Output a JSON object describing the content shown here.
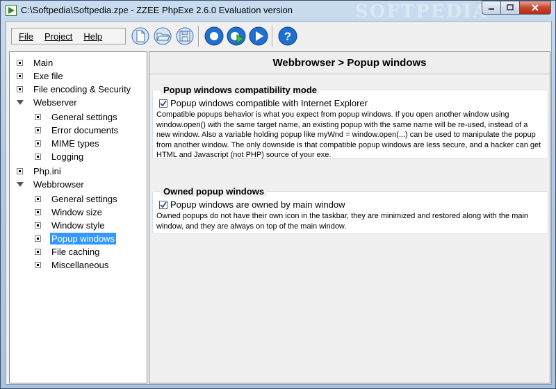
{
  "window": {
    "title": "C:\\Softpedia\\Softpedia.zpe - ZZEE PhpExe 2.6.0 Evaluation version",
    "watermark": "SOFTPEDIA"
  },
  "menu": {
    "file": "File",
    "project": "Project",
    "help": "Help"
  },
  "toolbar": {
    "icons": [
      "new-document-icon",
      "open-folder-icon",
      "save-disk-icon",
      "record-icon",
      "compile-run-icon",
      "play-icon",
      "help-icon"
    ]
  },
  "tree": [
    {
      "label": "Main",
      "type": "leaf",
      "level": 0
    },
    {
      "label": "Exe file",
      "type": "leaf",
      "level": 0
    },
    {
      "label": "File encoding & Security",
      "type": "leaf",
      "level": 0
    },
    {
      "label": "Webserver",
      "type": "branch",
      "level": 0
    },
    {
      "label": "General settings",
      "type": "leaf",
      "level": 1
    },
    {
      "label": "Error documents",
      "type": "leaf",
      "level": 1
    },
    {
      "label": "MIME types",
      "type": "leaf",
      "level": 1
    },
    {
      "label": "Logging",
      "type": "leaf",
      "level": 1
    },
    {
      "label": "Php.ini",
      "type": "leaf",
      "level": 0
    },
    {
      "label": "Webbrowser",
      "type": "branch",
      "level": 0
    },
    {
      "label": "General settings",
      "type": "leaf",
      "level": 1
    },
    {
      "label": "Window size",
      "type": "leaf",
      "level": 1
    },
    {
      "label": "Window style",
      "type": "leaf",
      "level": 1
    },
    {
      "label": "Popup windows",
      "type": "leaf",
      "level": 1,
      "selected": true
    },
    {
      "label": "File caching",
      "type": "leaf",
      "level": 1
    },
    {
      "label": "Miscellaneous",
      "type": "leaf",
      "level": 1
    }
  ],
  "page": {
    "header": "Webbrowser > Popup windows",
    "group1": {
      "title": "Popup windows compatibility mode",
      "checkbox_label": "Popup windows compatible with Internet Explorer",
      "checked": true,
      "description": "Compatible popups behavior is what you expect from popup windows. If you open another window using\nwindow.open() with the same target name, an existing popup with the same name will be re-used, instead of a\nnew window. Also a variable holding popup like myWnd = window.open(...) can be used to manipulate the popup\nfrom another window. The only downside is that compatible popup windows are less secure, and a hacker can get\nHTML and Javascript (not PHP) source of your exe."
    },
    "group2": {
      "title": "Owned popup windows",
      "checkbox_label": "Popup windows are owned by main window",
      "checked": true,
      "description": "Owned popups do not have their own icon in the taskbar, they are minimized and restored along with the main\nwindow, and they are always on top of the main window."
    }
  },
  "colors": {
    "selection": "#3399ff",
    "toolbar_blue": "#1f6fd1"
  }
}
